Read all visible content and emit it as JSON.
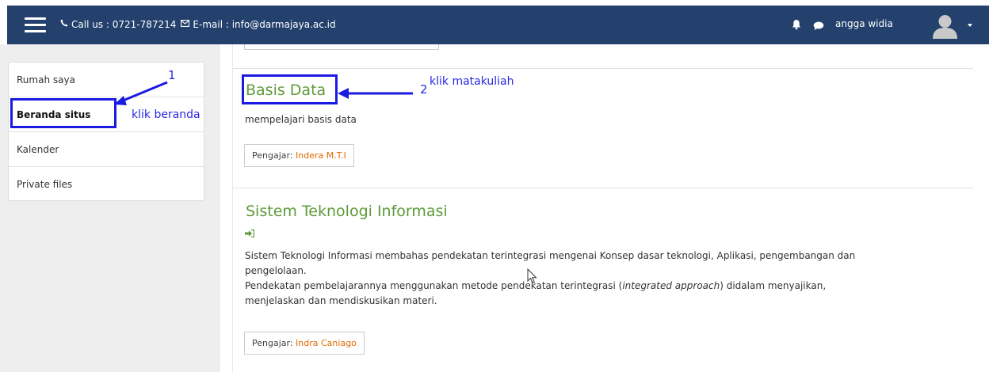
{
  "navbar": {
    "contact_phone": "Call us : 0721-787214",
    "contact_email": "E-mail : info@darmajaya.ac.id",
    "username": "angga widia",
    "icons": [
      "hamburger-menu-icon",
      "phone-icon",
      "email-icon",
      "bell-icon",
      "chat-icon",
      "user-avatar-icon",
      "caret-down-icon"
    ]
  },
  "sidebar": {
    "items": [
      {
        "label": "Rumah saya"
      },
      {
        "label": "Beranda situs"
      },
      {
        "label": "Kalender"
      },
      {
        "label": "Private files"
      }
    ]
  },
  "courses": [
    {
      "title": "Basis Data",
      "summary": "mempelajari basis data",
      "teacher_label": "Pengajar:",
      "teacher_name": "Indera M.T.I"
    },
    {
      "title": "Sistem Teknologi Informasi",
      "summary_line1": "Sistem Teknologi Informasi membahas pendekatan terintegrasi mengenai Konsep dasar teknologi, Aplikasi, pengembangan dan",
      "summary_line2": "pengelolaan.",
      "summary_line3_before": "Pendekatan pembelajarannya menggunakan metode pendekatan terintegrasi (",
      "summary_line3_em": "integrated approach",
      "summary_line3_after": ") didalam menyajikan,",
      "summary_line4": "menjelaskan dan mendiskusikan materi.",
      "teacher_label": "Pengajar:",
      "teacher_name": "Indra Caniago"
    }
  ],
  "annotations": {
    "num1": "1",
    "text1": "klik beranda",
    "num2": "2",
    "text2": "klik matakuliah",
    "color": "#1a1ae0"
  },
  "colors": {
    "navbar_bg": "#24406d",
    "course_title": "#5e9a3a",
    "teacher_link": "#e06b00"
  }
}
